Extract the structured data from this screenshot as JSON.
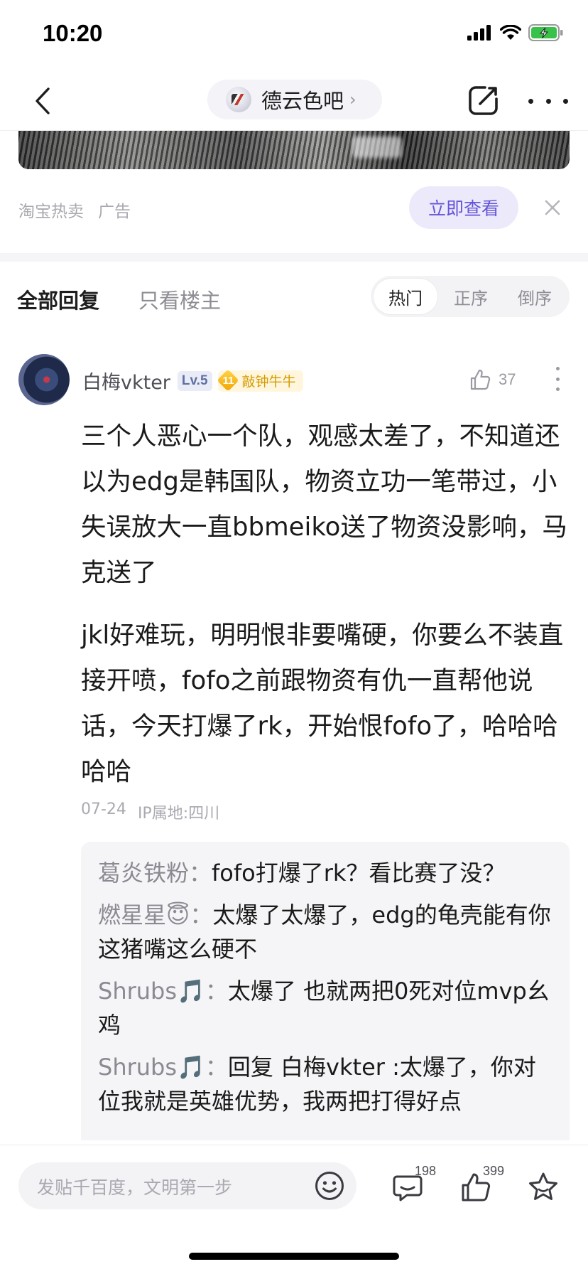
{
  "status_bar": {
    "time": "10:20"
  },
  "nav": {
    "forum_name": "德云色吧",
    "chevron": "›"
  },
  "ad": {
    "source": "淘宝热卖",
    "tag": "广告",
    "cta_label": "立即查看"
  },
  "reply_tabs": {
    "all": "全部回复",
    "op_only": "只看楼主",
    "sort": [
      "热门",
      "正序",
      "倒序"
    ],
    "sort_active": "热门"
  },
  "comment": {
    "author": "白梅vkter",
    "level": "Lv.5",
    "medal_level": "11",
    "medal_name": "敲钟牛牛",
    "likes": "37",
    "paragraphs": [
      "三个人恶心一个队，观感太差了，不知道还以为edg是韩国队，物资立功一笔带过，小失误放大一直bbmeiko送了物资没影响，马克送了",
      "jkl好难玩，明明恨非要嘴硬，你要么不装直接开喷，fofo之前跟物资有仇一直帮他说话，今天打爆了rk，开始恨fofo了，哈哈哈哈哈"
    ],
    "date": "07-24",
    "ip_location": "IP属地:四川",
    "replies": [
      {
        "user": "葛炎铁粉",
        "sep": "：",
        "text": "fofo打爆了rk？看比赛了没？"
      },
      {
        "user": "燃星星😇",
        "sep": "：",
        "text": "太爆了太爆了，edg的龟壳能有你这猪嘴这么硬不"
      },
      {
        "user": "Shrubs🎵",
        "sep": "：",
        "text": "太爆了 也就两把0死对位mvp幺鸡"
      },
      {
        "user": "Shrubs🎵",
        "sep": "：",
        "text": "回复 白梅vkter :太爆了，你对位我就是英雄优势，我两把打得好点"
      }
    ]
  },
  "bottom_bar": {
    "input_placeholder": "发贴千百度，文明第一步",
    "comment_count": "198",
    "like_count": "399"
  },
  "colors": {
    "accent": "#6455d8",
    "cta_bg": "#ece9fb",
    "medal": "#d59a00"
  },
  "icons": [
    "back-icon",
    "edit-icon",
    "more-icon",
    "close-icon",
    "thumbs-up-icon",
    "emoji-icon",
    "comment-icon",
    "star-icon",
    "signal-icon",
    "wifi-icon",
    "battery-icon"
  ]
}
